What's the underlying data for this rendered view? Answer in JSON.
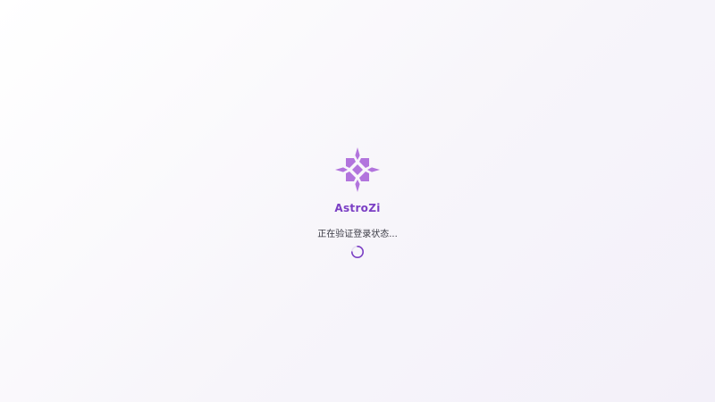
{
  "app": {
    "name": "AstroZi",
    "status_text": "正在验证登录状态..."
  },
  "icons": {
    "logo": "astrozi-flower-logo",
    "loader": "loading-spinner"
  },
  "colors": {
    "brand": "#7b3fc4",
    "logo_fill": "#b274dd",
    "text": "#3a3a44",
    "background": "#f7f5fa"
  }
}
